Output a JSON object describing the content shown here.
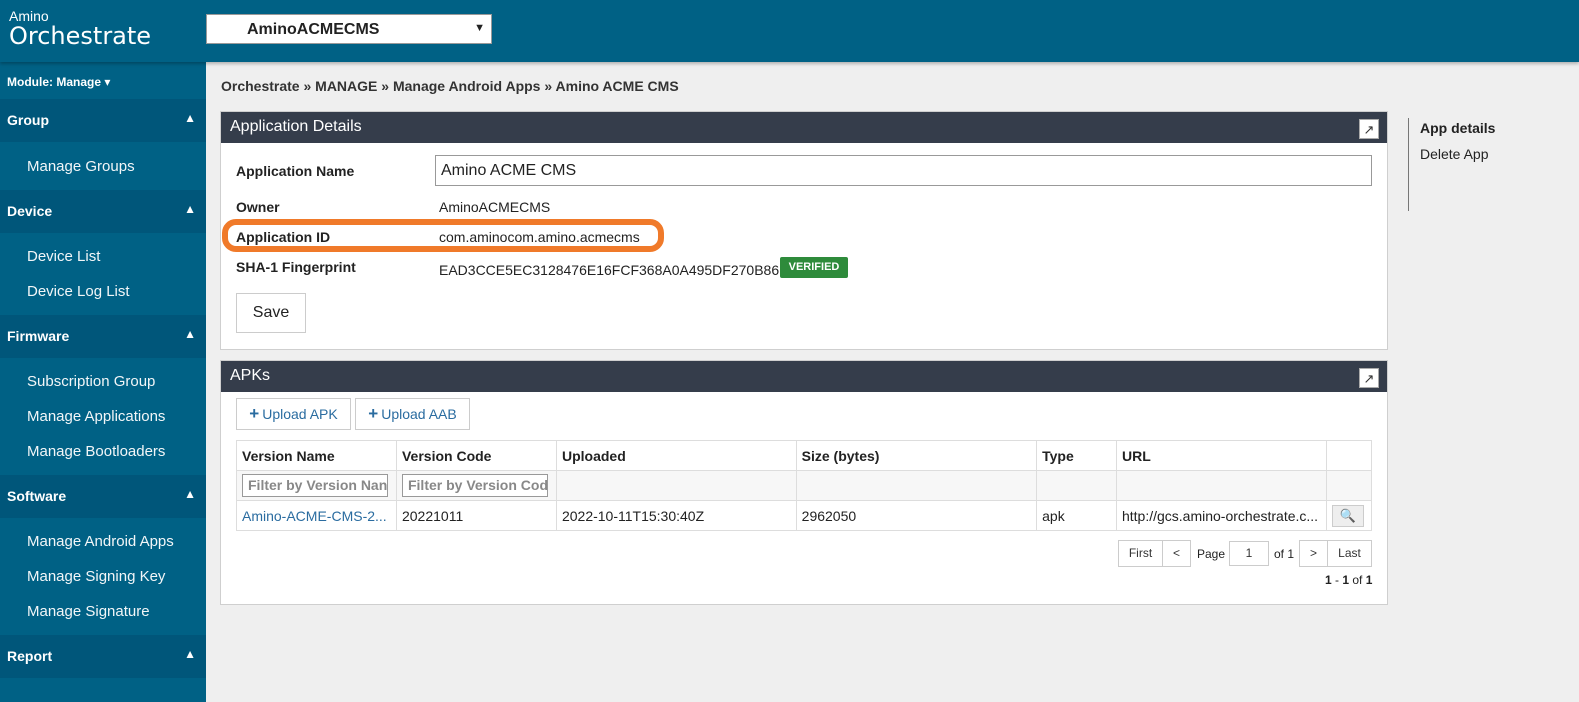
{
  "header": {
    "logo_small": "Amino",
    "logo_big": "Orchestrate",
    "tenant_value": "AminoACMECMS"
  },
  "sidebar": {
    "module_label": "Module: Manage ▾",
    "sections": [
      {
        "title": "Group",
        "items": [
          "Manage Groups"
        ]
      },
      {
        "title": "Device",
        "items": [
          "Device List",
          "Device Log List"
        ]
      },
      {
        "title": "Firmware",
        "items": [
          "Subscription Group",
          "Manage Applications",
          "Manage Bootloaders"
        ]
      },
      {
        "title": "Software",
        "items": [
          "Manage Android Apps",
          "Manage Signing Key",
          "Manage Signature"
        ]
      },
      {
        "title": "Report",
        "items": []
      }
    ]
  },
  "breadcrumb": "Orchestrate » MANAGE » Manage Android Apps » Amino ACME CMS",
  "app_details": {
    "title": "Application Details",
    "name_label": "Application Name",
    "name_value": "Amino ACME CMS",
    "owner_label": "Owner",
    "owner_value": "AminoACMECMS",
    "appid_label": "Application ID",
    "appid_value": "com.aminocom.amino.acmecms",
    "sha_label": "SHA-1 Fingerprint",
    "sha_value": "EAD3CCE5EC3128476E16FCF368A0A495DF270B86",
    "verified_badge": "VERIFIED",
    "save_label": "Save"
  },
  "apks": {
    "title": "APKs",
    "upload_apk": "Upload APK",
    "upload_aab": "Upload AAB",
    "columns": [
      "Version Name",
      "Version Code",
      "Uploaded",
      "Size (bytes)",
      "Type",
      "URL"
    ],
    "filter_version_name": "Filter by Version Nan",
    "filter_version_code": "Filter by Version Cod",
    "rows": [
      {
        "version_name": "Amino-ACME-CMS-2...",
        "version_code": "20221011",
        "uploaded": "2022-10-11T15:30:40Z",
        "size": "2962050",
        "type": "apk",
        "url": "http://gcs.amino-orchestrate.c..."
      }
    ],
    "pager": {
      "first": "First",
      "prev": "<",
      "page_label": "Page",
      "page_value": "1",
      "of_label": "of 1",
      "next": ">",
      "last": "Last",
      "range_start": "1",
      "range_sep": " - ",
      "range_end": "1",
      "range_of": " of ",
      "range_total": "1"
    }
  },
  "right_nav": {
    "heading": "App details",
    "delete": "Delete App"
  },
  "colors": {
    "brand": "#006185",
    "panel_header": "#353d4b",
    "highlight": "#f07a2a",
    "verified": "#2e8b3b",
    "link": "#2a6ca0"
  }
}
